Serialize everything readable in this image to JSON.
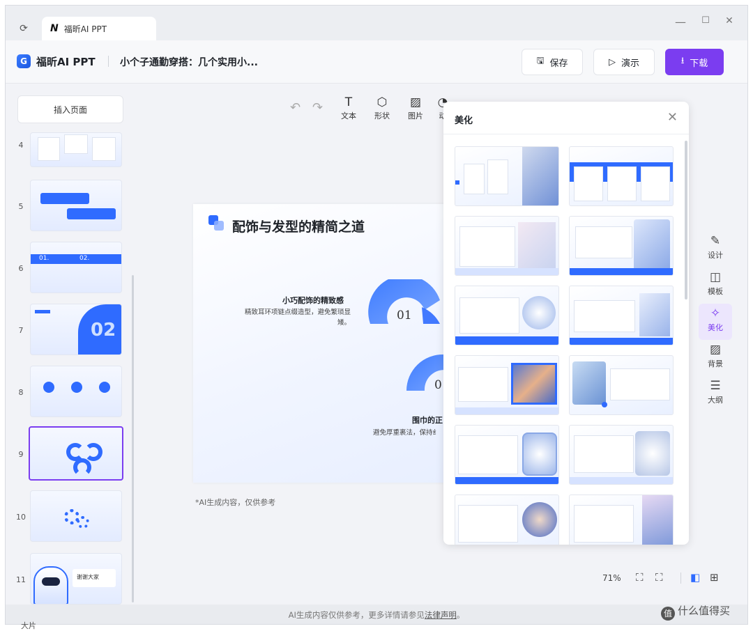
{
  "window": {
    "tab_title": "福昕AI PPT",
    "tab_logo": "N",
    "controls": {
      "minimize": "—",
      "maximize": "☐",
      "close": "✕"
    }
  },
  "header": {
    "app_logo": "G",
    "app_name": "福昕AI PPT",
    "doc_title": "小个子通勤穿搭：几个实用小...",
    "save_label": "保存",
    "present_label": "演示",
    "download_label": "下载"
  },
  "left": {
    "insert_label": "插入页面",
    "slides": [
      {
        "num": "4"
      },
      {
        "num": "5"
      },
      {
        "num": "6"
      },
      {
        "num": "7"
      },
      {
        "num": "8"
      },
      {
        "num": "9"
      },
      {
        "num": "10"
      },
      {
        "num": "11"
      }
    ],
    "thumb6_a": "01.",
    "thumb6_b": "02.",
    "thumb7_big": "02",
    "thumb11_text": "谢谢大家"
  },
  "toolbar": {
    "undo_icon": "undo-icon",
    "redo_icon": "redo-icon",
    "text_label": "文本",
    "shape_label": "形状",
    "image_label": "图片",
    "partial_label": "动"
  },
  "slide": {
    "title": "配饰与发型的精简之道",
    "section1_title": "小巧配饰的精致感",
    "section1_body": "精致耳环项链点缀造型，避免繁琐显矮。",
    "num1": "01",
    "num2": "0",
    "section2_title": "围巾的正",
    "section2_body": "避免厚重裹法，保持纟"
  },
  "ai_note": "*AI生成内容，仅供参考",
  "beautify": {
    "title": "美化",
    "close": "✕",
    "template_count": 12
  },
  "right_sidebar": [
    {
      "label": "设计",
      "icon": "pen-icon"
    },
    {
      "label": "模板",
      "icon": "layout-icon"
    },
    {
      "label": "美化",
      "icon": "magic-wand-icon",
      "active": true
    },
    {
      "label": "背景",
      "icon": "background-icon"
    },
    {
      "label": "大纲",
      "icon": "outline-icon"
    }
  ],
  "zoom": {
    "level": "71%"
  },
  "footer": {
    "text": "AI生成内容仅供参考，更多详情请参见",
    "link": "法律声明",
    "end": "。"
  },
  "watermark": {
    "text": "什么值得买",
    "logo": "值"
  },
  "bottom_trunc": "大片",
  "colors": {
    "accent": "#7b3df0",
    "blue": "#2f6bff"
  }
}
